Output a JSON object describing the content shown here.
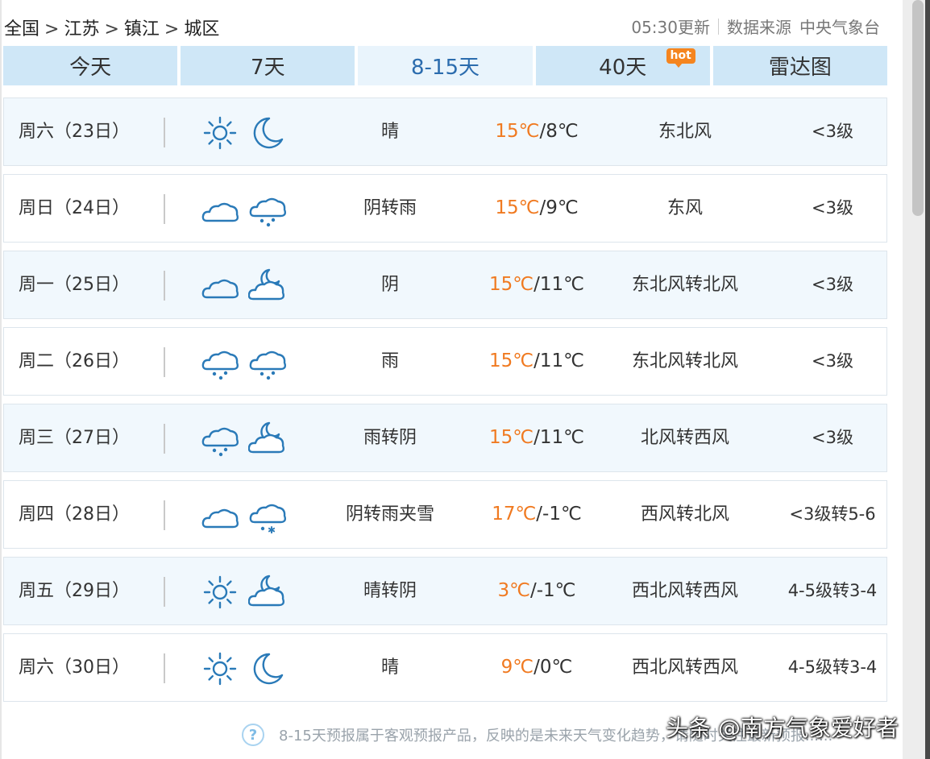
{
  "breadcrumb": [
    "全国",
    "江苏",
    "镇江",
    "城区"
  ],
  "breadcrumb_sep": ">",
  "update": {
    "time": "05:30更新",
    "source_label": "数据来源",
    "source": "中央气象台"
  },
  "tabs": [
    {
      "label": "今天",
      "active": false
    },
    {
      "label": "7天",
      "active": false
    },
    {
      "label": "8-15天",
      "active": true
    },
    {
      "label": "40天",
      "active": false,
      "badge": "hot"
    },
    {
      "label": "雷达图",
      "active": false
    }
  ],
  "forecast": [
    {
      "day": "周六（23日）",
      "icons": [
        "sun-icon",
        "moon-icon"
      ],
      "weather": "晴",
      "high": "15℃",
      "low": "8℃",
      "wind": "东北风",
      "level": "<3级"
    },
    {
      "day": "周日（24日）",
      "icons": [
        "cloud-icon",
        "rain-cloud-icon"
      ],
      "weather": "阴转雨",
      "high": "15℃",
      "low": "9℃",
      "wind": "东风",
      "level": "<3级"
    },
    {
      "day": "周一（25日）",
      "icons": [
        "cloud-icon",
        "moon-cloud-icon"
      ],
      "weather": "阴",
      "high": "15℃",
      "low": "11℃",
      "wind": "东北风转北风",
      "level": "<3级"
    },
    {
      "day": "周二（26日）",
      "icons": [
        "rain-cloud-icon",
        "rain-cloud-icon"
      ],
      "weather": "雨",
      "high": "15℃",
      "low": "11℃",
      "wind": "东北风转北风",
      "level": "<3级"
    },
    {
      "day": "周三（27日）",
      "icons": [
        "rain-cloud-icon",
        "moon-cloud-icon"
      ],
      "weather": "雨转阴",
      "high": "15℃",
      "low": "11℃",
      "wind": "北风转西风",
      "level": "<3级"
    },
    {
      "day": "周四（28日）",
      "icons": [
        "cloud-icon",
        "sleet-cloud-icon"
      ],
      "weather": "阴转雨夹雪",
      "high": "17℃",
      "low": "-1℃",
      "wind": "西风转北风",
      "level": "<3级转5-6"
    },
    {
      "day": "周五（29日）",
      "icons": [
        "sun-icon",
        "moon-cloud-icon"
      ],
      "weather": "晴转阴",
      "high": "3℃",
      "low": "-1℃",
      "wind": "西北风转西风",
      "level": "4-5级转3-4"
    },
    {
      "day": "周六（30日）",
      "icons": [
        "sun-icon",
        "moon-icon"
      ],
      "weather": "晴",
      "high": "9℃",
      "low": "0℃",
      "wind": "西北风转西风",
      "level": "4-5级转3-4"
    }
  ],
  "temp_sep": "/",
  "footer": {
    "help_glyph": "?",
    "note": "8-15天预报属于客观预报产品，反映的是未来天气变化趋势，请随时关注最新预报......"
  },
  "watermark": "头条 @南方气象爱好者",
  "colors": {
    "tab_bg": "#cfe7f7",
    "tab_active_bg": "#e9f4fc",
    "tab_active_text": "#2b6cae",
    "high_temp": "#f07a21",
    "icon_blue": "#2a7ab8",
    "hot_badge": "#f5851f"
  }
}
